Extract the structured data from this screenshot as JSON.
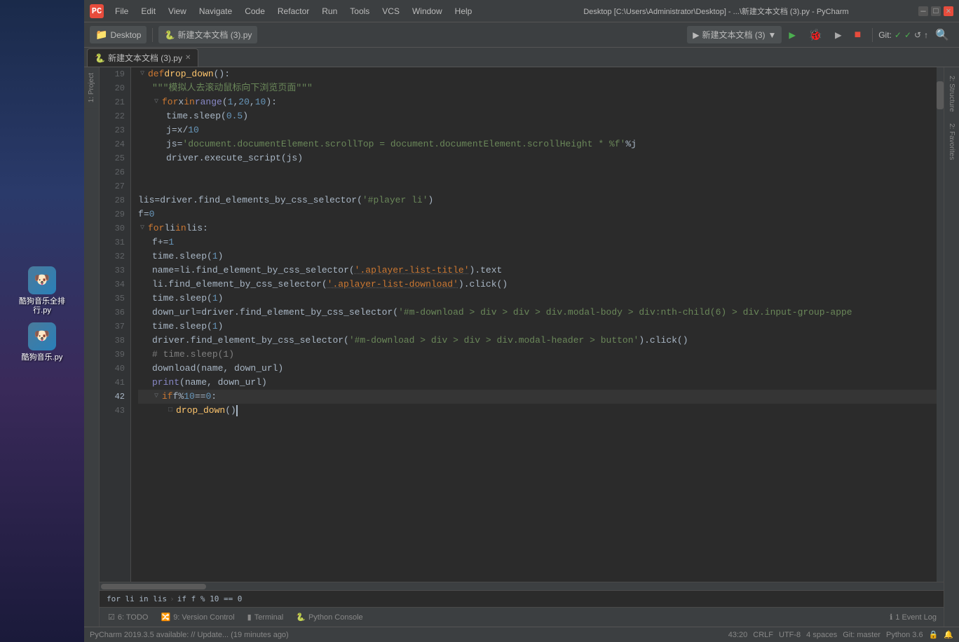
{
  "window": {
    "title": "Desktop [C:\\Users\\Administrator\\Desktop] - ...\\新建文本文档 (3).py - PyCharm",
    "app_name": "PyCharm",
    "app_icon": "PC"
  },
  "menu": {
    "items": [
      "File",
      "Edit",
      "View",
      "Navigate",
      "Code",
      "Refactor",
      "Run",
      "Tools",
      "VCS",
      "Window",
      "Help"
    ]
  },
  "toolbar": {
    "folder_label": "Desktop",
    "file_label": "新建文本文档 (3).py",
    "run_file_label": "新建文本文档 (3)",
    "git_label": "Git:",
    "checkmark1": "✓",
    "checkmark2": "✓"
  },
  "tab": {
    "file_name": "新建文本文档 (3).py"
  },
  "code": {
    "lines": [
      {
        "num": 19,
        "content": "def drop_down():"
      },
      {
        "num": 20,
        "content": "    \"\"\"模拟人去滚动鼠标向下浏览页面\"\"\""
      },
      {
        "num": 21,
        "content": "    for x in range(1, 20, 10):"
      },
      {
        "num": 22,
        "content": "        time.sleep(0.5)"
      },
      {
        "num": 23,
        "content": "        j = x / 10"
      },
      {
        "num": 24,
        "content": "        js = 'document.documentElement.scrollTop = document.documentElement.scrollHeight * %f' % j"
      },
      {
        "num": 25,
        "content": "        driver.execute_script(js)"
      },
      {
        "num": 26,
        "content": ""
      },
      {
        "num": 27,
        "content": ""
      },
      {
        "num": 28,
        "content": "lis = driver.find_elements_by_css_selector('#player li')"
      },
      {
        "num": 29,
        "content": "f = 0"
      },
      {
        "num": 30,
        "content": "for li in lis:"
      },
      {
        "num": 31,
        "content": "    f += 1"
      },
      {
        "num": 32,
        "content": "    time.sleep(1)"
      },
      {
        "num": 33,
        "content": "    name = li.find_element_by_css_selector('.aplayer-list-title').text"
      },
      {
        "num": 34,
        "content": "    li.find_element_by_css_selector('.aplayer-list-download').click()"
      },
      {
        "num": 35,
        "content": "    time.sleep(1)"
      },
      {
        "num": 36,
        "content": "    down_url = driver.find_element_by_css_selector('#m-download > div > div > div.modal-body > div:nth-child(6) > div.input-group-appe"
      },
      {
        "num": 37,
        "content": "    time.sleep(1)"
      },
      {
        "num": 38,
        "content": "    driver.find_element_by_css_selector('#m-download > div > div > div.modal-header > button').click()"
      },
      {
        "num": 39,
        "content": "    # time.sleep(1)"
      },
      {
        "num": 40,
        "content": "    download(name, down_url)"
      },
      {
        "num": 41,
        "content": "    print(name, down_url)"
      },
      {
        "num": 42,
        "content": "    if f % 10 == 0:"
      },
      {
        "num": 43,
        "content": "        drop_down()"
      }
    ]
  },
  "breadcrumb": {
    "items": [
      "for li in lis",
      "if f % 10 == 0"
    ]
  },
  "bottom_tabs": {
    "todo": "6: TODO",
    "version_control": "9: Version Control",
    "terminal": "Terminal",
    "python_console": "Python Console"
  },
  "status_bar": {
    "update": "PyCharm 2019.3.5 available: // Update... (19 minutes ago)",
    "position": "43:20",
    "line_ending": "CRLF",
    "encoding": "UTF-8",
    "indent": "4 spaces",
    "git": "Git: master",
    "python": "Python 3.6"
  },
  "side_panels": {
    "project": "1: Project",
    "structure": "2: Structure",
    "favorites": "2: Favorites"
  },
  "event_log": "1 Event Log",
  "desktop_icons": [
    {
      "label": "酷狗音乐全排行.py",
      "icon": "🐶"
    },
    {
      "label": "酷狗音乐.py",
      "icon": "🐶"
    }
  ]
}
